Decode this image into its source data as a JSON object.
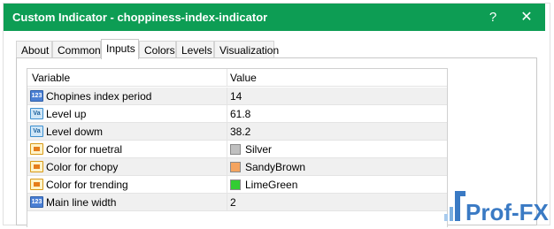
{
  "window": {
    "title": "Custom Indicator - choppiness-index-indicator",
    "help_glyph": "?",
    "close_glyph": "✕"
  },
  "tabs": [
    {
      "label": "About",
      "active": false
    },
    {
      "label": "Common",
      "active": false
    },
    {
      "label": "Inputs",
      "active": true
    },
    {
      "label": "Colors",
      "active": false
    },
    {
      "label": "Levels",
      "active": false
    },
    {
      "label": "Visualization",
      "active": false
    }
  ],
  "table": {
    "headers": {
      "variable": "Variable",
      "value": "Value"
    },
    "rows": [
      {
        "icon": "integer-icon",
        "icon_text": "123",
        "variable": "Chopines index period",
        "value": "14"
      },
      {
        "icon": "double-icon",
        "icon_text": "Va",
        "variable": "Level up",
        "value": "61.8"
      },
      {
        "icon": "double-icon",
        "icon_text": "Va",
        "variable": "Level dowm",
        "value": "38.2"
      },
      {
        "icon": "color-icon",
        "icon_text": "",
        "variable": "Color for nuetral",
        "value": "Silver",
        "swatch": "#c0c0c0"
      },
      {
        "icon": "color-icon",
        "icon_text": "",
        "variable": "Color for chopy",
        "value": "SandyBrown",
        "swatch": "#f4a460"
      },
      {
        "icon": "color-icon",
        "icon_text": "",
        "variable": "Color for trending",
        "value": "LimeGreen",
        "swatch": "#32cd32"
      },
      {
        "icon": "integer-icon",
        "icon_text": "123",
        "variable": "Main line width",
        "value": "2"
      }
    ]
  },
  "watermark": {
    "text": "Prof-FX"
  },
  "colors": {
    "titlebar": "#0d9d54",
    "logo": "#3a7ac4"
  }
}
